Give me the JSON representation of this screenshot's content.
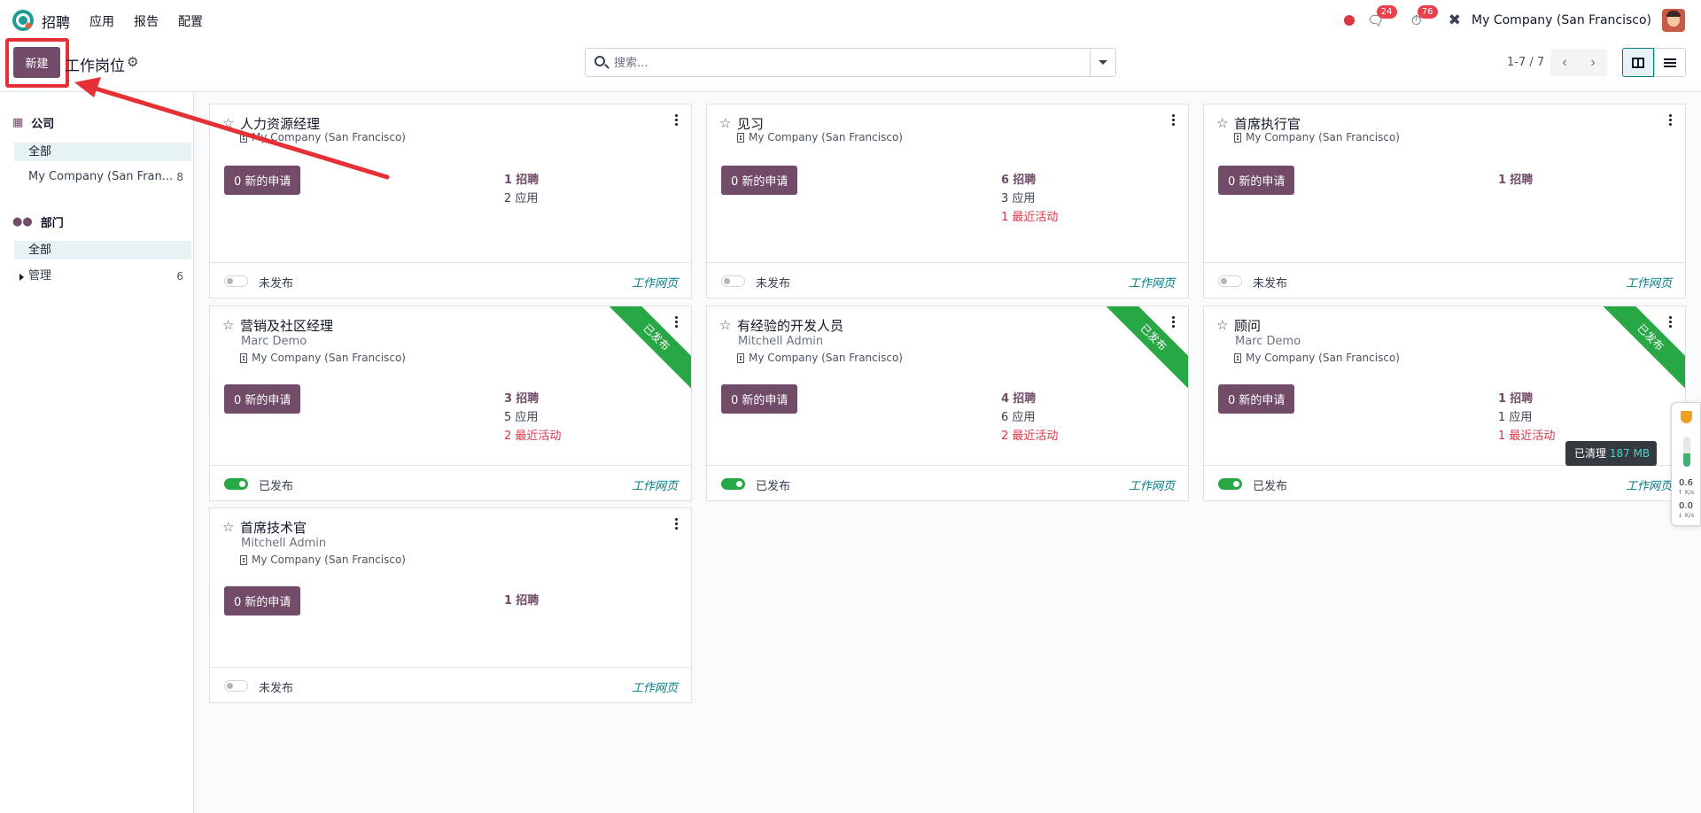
{
  "navbar": {
    "app_name": "招聘",
    "menu": [
      "应用",
      "报告",
      "配置"
    ],
    "chat_badge": "24",
    "activity_badge": "76",
    "company": "My Company (San Francisco)"
  },
  "control": {
    "new_label": "新建",
    "page_title": "工作岗位",
    "search_placeholder": "搜索...",
    "pager": "1-7 / 7"
  },
  "sidebar": {
    "company_heading": "公司",
    "company_all": "全部",
    "company_item": {
      "label": "My Company (San Fran...",
      "count": "8"
    },
    "dept_heading": "部门",
    "dept_all": "全部",
    "dept_item": {
      "label": "管理",
      "count": "6"
    }
  },
  "cards": [
    {
      "title": "人力资源经理",
      "manager": "",
      "company": "My Company (San Francisco)",
      "apps_btn": "0 新的申请",
      "recruit": "1",
      "recruit_label": "招聘",
      "apps": "2 应用",
      "activity": "",
      "published": false,
      "pub_label": "未发布",
      "web": "工作网页",
      "ribbon": ""
    },
    {
      "title": "见习",
      "manager": "",
      "company": "My Company (San Francisco)",
      "apps_btn": "0 新的申请",
      "recruit": "6",
      "recruit_label": "招聘",
      "apps": "3 应用",
      "activity": "1 最近活动",
      "published": false,
      "pub_label": "未发布",
      "web": "工作网页",
      "ribbon": ""
    },
    {
      "title": "首席执行官",
      "manager": "",
      "company": "My Company (San Francisco)",
      "apps_btn": "0 新的申请",
      "recruit": "1",
      "recruit_label": "招聘",
      "apps": "",
      "activity": "",
      "published": false,
      "pub_label": "未发布",
      "web": "工作网页",
      "ribbon": ""
    },
    {
      "title": "营销及社区经理",
      "manager": "Marc Demo",
      "company": "My Company (San Francisco)",
      "apps_btn": "0 新的申请",
      "recruit": "3",
      "recruit_label": "招聘",
      "apps": "5 应用",
      "activity": "2 最近活动",
      "published": true,
      "pub_label": "已发布",
      "web": "工作网页",
      "ribbon": "已发布"
    },
    {
      "title": "有经验的开发人员",
      "manager": "Mitchell Admin",
      "company": "My Company (San Francisco)",
      "apps_btn": "0 新的申请",
      "recruit": "4",
      "recruit_label": "招聘",
      "apps": "6 应用",
      "activity": "2 最近活动",
      "published": true,
      "pub_label": "已发布",
      "web": "工作网页",
      "ribbon": "已发布"
    },
    {
      "title": "顾问",
      "manager": "Marc Demo",
      "company": "My Company (San Francisco)",
      "apps_btn": "0 新的申请",
      "recruit": "1",
      "recruit_label": "招聘",
      "apps": "1 应用",
      "activity": "1 最近活动",
      "published": true,
      "pub_label": "已发布",
      "web": "工作网页",
      "ribbon": "已发布"
    },
    {
      "title": "首席技术官",
      "manager": "Mitchell Admin",
      "company": "My Company (San Francisco)",
      "apps_btn": "0 新的申请",
      "recruit": "1",
      "recruit_label": "招聘",
      "apps": "",
      "activity": "",
      "published": false,
      "pub_label": "未发布",
      "web": "工作网页",
      "ribbon": ""
    }
  ],
  "tooltip": {
    "label": "已清理",
    "value": "187 MB"
  },
  "monitor": {
    "memory_fill": 0.45,
    "up_value": "0.6",
    "up_unit": "↑ K/s",
    "down_value": "0.0",
    "down_unit": "↓ K/s"
  },
  "colors": {
    "brand": "#714b67",
    "accent": "#017e84",
    "published": "#28a745",
    "danger": "#dc3545",
    "annotation": "#e53036"
  }
}
